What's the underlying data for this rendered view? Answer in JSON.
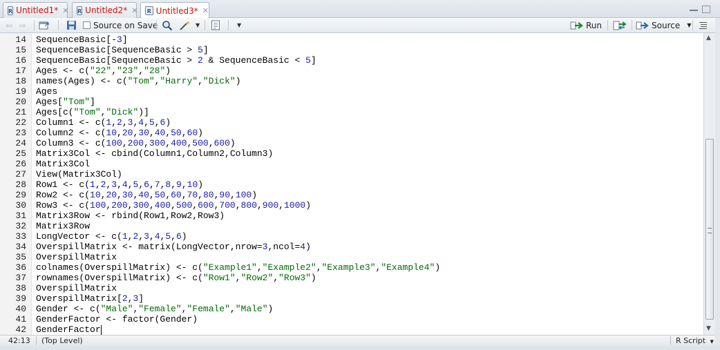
{
  "tabs": [
    {
      "label": "Untitled1*",
      "active": false
    },
    {
      "label": "Untitled2*",
      "active": false
    },
    {
      "label": "Untitled3*",
      "active": true
    }
  ],
  "toolbar": {
    "source_on_save_label": "Source on Save",
    "run_label": "Run",
    "source_label": "Source"
  },
  "editor": {
    "lines": [
      {
        "n": "14",
        "t": "SequenceBasic[-3]"
      },
      {
        "n": "15",
        "t": "SequenceBasic[SequenceBasic > 5]"
      },
      {
        "n": "16",
        "t": "SequenceBasic[SequenceBasic > 2 & SequenceBasic < 5]"
      },
      {
        "n": "17",
        "t": "Ages <- c(\"22\",\"23\",\"28\")"
      },
      {
        "n": "18",
        "t": "names(Ages) <- c(\"Tom\",\"Harry\",\"Dick\")"
      },
      {
        "n": "19",
        "t": "Ages"
      },
      {
        "n": "20",
        "t": "Ages[\"Tom\"]"
      },
      {
        "n": "21",
        "t": "Ages[c(\"Tom\",\"Dick\")]"
      },
      {
        "n": "22",
        "t": "Column1 <- c(1,2,3,4,5,6)"
      },
      {
        "n": "23",
        "t": "Column2 <- c(10,20,30,40,50,60)"
      },
      {
        "n": "24",
        "t": "Column3 <- c(100,200,300,400,500,600)"
      },
      {
        "n": "25",
        "t": "Matrix3Col <- cbind(Column1,Column2,Column3)"
      },
      {
        "n": "26",
        "t": "Matrix3Col"
      },
      {
        "n": "27",
        "t": "View(Matrix3Col)"
      },
      {
        "n": "28",
        "t": "Row1 <- c(1,2,3,4,5,6,7,8,9,10)"
      },
      {
        "n": "29",
        "t": "Row2 <- c(10,20,30,40,50,60,70,80,90,100)"
      },
      {
        "n": "30",
        "t": "Row3 <- c(100,200,300,400,500,600,700,800,900,1000)"
      },
      {
        "n": "31",
        "t": "Matrix3Row <- rbind(Row1,Row2,Row3)"
      },
      {
        "n": "32",
        "t": "Matrix3Row"
      },
      {
        "n": "33",
        "t": "LongVector <- c(1,2,3,4,5,6)"
      },
      {
        "n": "34",
        "t": "OverspillMatrix <- matrix(LongVector,nrow=3,ncol=4)"
      },
      {
        "n": "35",
        "t": "OverspillMatrix"
      },
      {
        "n": "36",
        "t": "colnames(OverspillMatrix) <- c(\"Example1\",\"Example2\",\"Example3\",\"Example4\")"
      },
      {
        "n": "37",
        "t": "rownames(OverspillMatrix) <- c(\"Row1\",\"Row2\",\"Row3\")"
      },
      {
        "n": "38",
        "t": "OverspillMatrix"
      },
      {
        "n": "39",
        "t": "OverspillMatrix[2,3]"
      },
      {
        "n": "40",
        "t": "Gender <- c(\"Male\",\"Female\",\"Female\",\"Male\")"
      },
      {
        "n": "41",
        "t": "GenderFactor <- factor(Gender)"
      },
      {
        "n": "42",
        "t": "GenderFactor"
      }
    ]
  },
  "status": {
    "position": "42:13",
    "scope": "(Top Level)",
    "file_type": "R Script"
  },
  "colors": {
    "tab_modified": "#cc1111",
    "numeric": "#1a1aa6",
    "string": "#036a07"
  }
}
